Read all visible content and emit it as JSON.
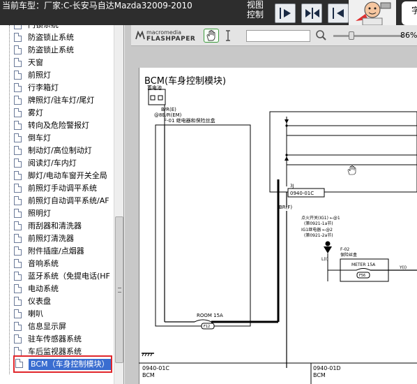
{
  "app": {
    "title": "当前车型：厂家:C-长安马自达Mazda32009-2010",
    "view_label": "视图控制",
    "right_char": "字"
  },
  "toolbar": {
    "buttons": [
      {
        "name": "next-page-button",
        "icon": "arrow-right-icon"
      },
      {
        "name": "fit-width-button",
        "icon": "arrows-in-icon"
      },
      {
        "name": "prev-page-button",
        "icon": "arrow-left-icon"
      }
    ]
  },
  "tree": {
    "items": [
      {
        "label": "门锁系统"
      },
      {
        "label": "防盗锁止系统"
      },
      {
        "label": "防盗锁止系统"
      },
      {
        "label": "天窗"
      },
      {
        "label": "前照灯"
      },
      {
        "label": "行李箱灯"
      },
      {
        "label": "牌照灯/驻车灯/尾灯"
      },
      {
        "label": "雾灯"
      },
      {
        "label": "转向及危险警报灯"
      },
      {
        "label": "倒车灯"
      },
      {
        "label": "制动灯/高位制动灯"
      },
      {
        "label": "阅读灯/车内灯"
      },
      {
        "label": "脚灯/电动车窗开关全局"
      },
      {
        "label": "前照灯手动调平系统"
      },
      {
        "label": "前照灯自动调平系统/AF"
      },
      {
        "label": "照明灯"
      },
      {
        "label": "雨刮器和清洗器"
      },
      {
        "label": "前照灯清洗器"
      },
      {
        "label": "附件插座/点烟器"
      },
      {
        "label": "音响系统"
      },
      {
        "label": "蓝牙系统（免提电话(HF"
      },
      {
        "label": "电动系统"
      },
      {
        "label": "仪表盘"
      },
      {
        "label": "喇叭"
      },
      {
        "label": "信息显示屏"
      },
      {
        "label": "驻车传感器系统"
      },
      {
        "label": "车后监视器系统"
      }
    ],
    "selected": {
      "label": "BCM（车身控制模块）"
    }
  },
  "flashpaper": {
    "brand_line1": "macromedia",
    "brand_line2": "FLASHPAPER",
    "search_value": "",
    "zoom_value": "86%"
  },
  "document": {
    "title": "BCM(车身控制模块)",
    "labels": {
      "battery": "蓄电池",
      "wire1": "B/R(E)",
      "wire2": "@8B/R(EM)",
      "fuse_box": "F-01  继电器和保险丝盒",
      "conn_3j": "3J",
      "conn_code": "0940-01C",
      "wire_br": "BR(F)",
      "ign_switch": "点火开关(IG1) ←@1",
      "ign_ref1": "(第0921-1a节)",
      "ig1_relay": "IG1继电器 ←@2",
      "ign_ref2": "(第0921-2a节)",
      "wire_l": "L(I)",
      "f02": "F-02",
      "f02_name": "保险丝盒",
      "meter_fuse": "METER 15A",
      "meter_code": "F56",
      "wire_y": "Y(I)",
      "room_fuse": "ROOM 15A",
      "room_code": "F12",
      "footer_left_code": "0940-01C",
      "footer_left_name": "BCM",
      "footer_right_code": "0940-01D",
      "footer_right_name": "BCM"
    }
  }
}
